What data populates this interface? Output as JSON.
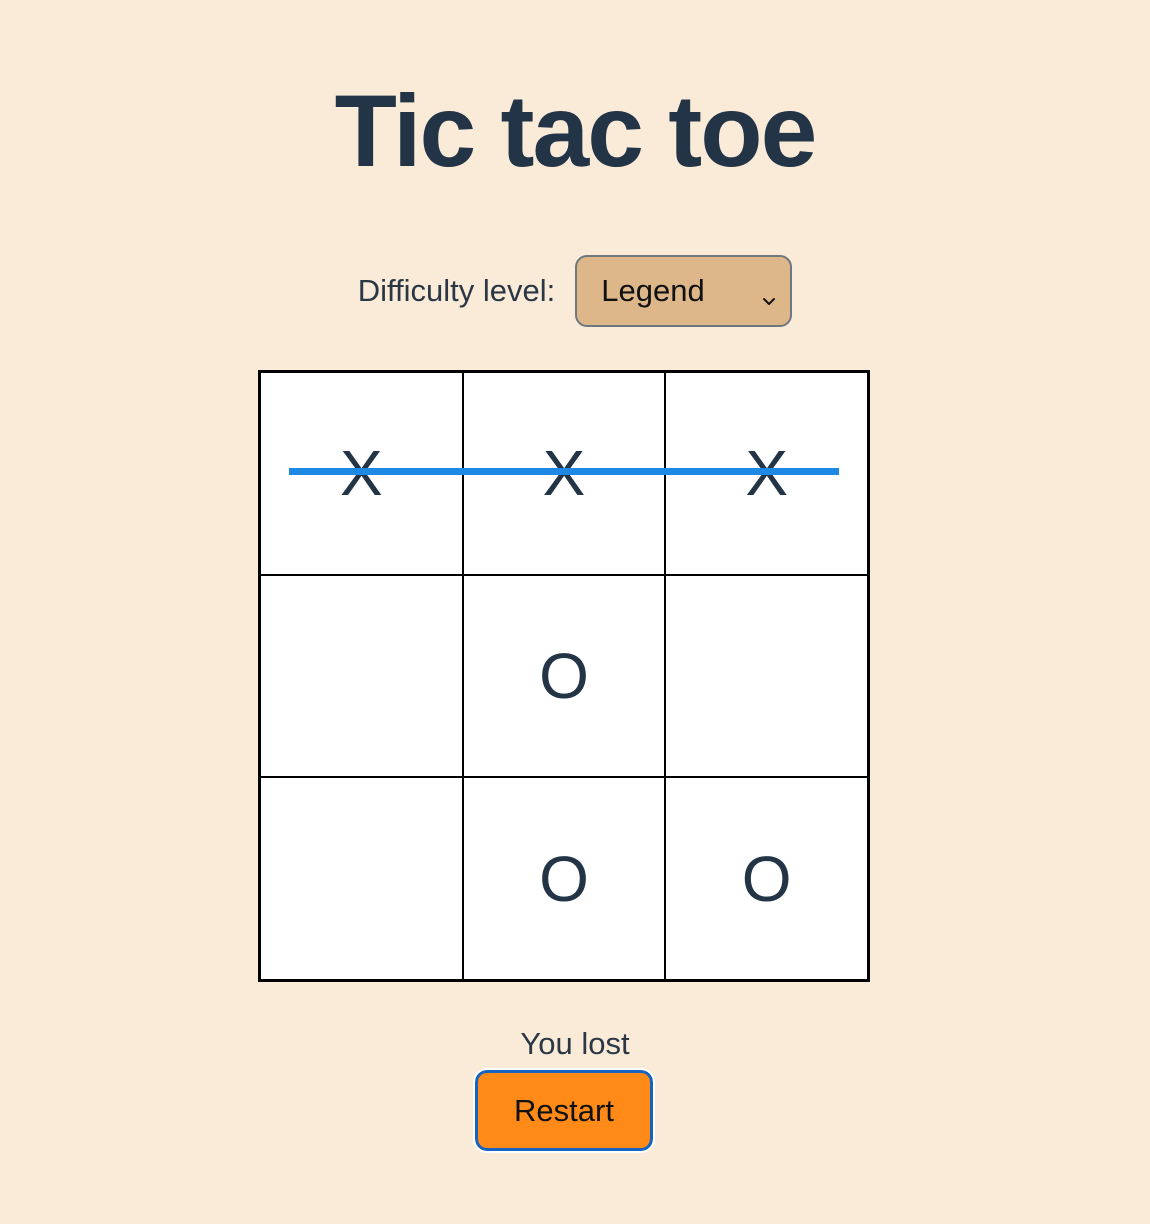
{
  "title": "Tic tac toe",
  "difficulty": {
    "label": "Difficulty level:",
    "selected": "Legend"
  },
  "board": {
    "cells": [
      "X",
      "X",
      "X",
      "",
      "O",
      "",
      "",
      "O",
      "O"
    ],
    "winning_line": "top-row",
    "win_line_color": "#1e88e5"
  },
  "status": "You lost",
  "restart_label": "Restart",
  "colors": {
    "background": "#faebd9",
    "select_bg": "#ddb78a",
    "restart_bg": "#ff8a17",
    "text": "#233447"
  }
}
